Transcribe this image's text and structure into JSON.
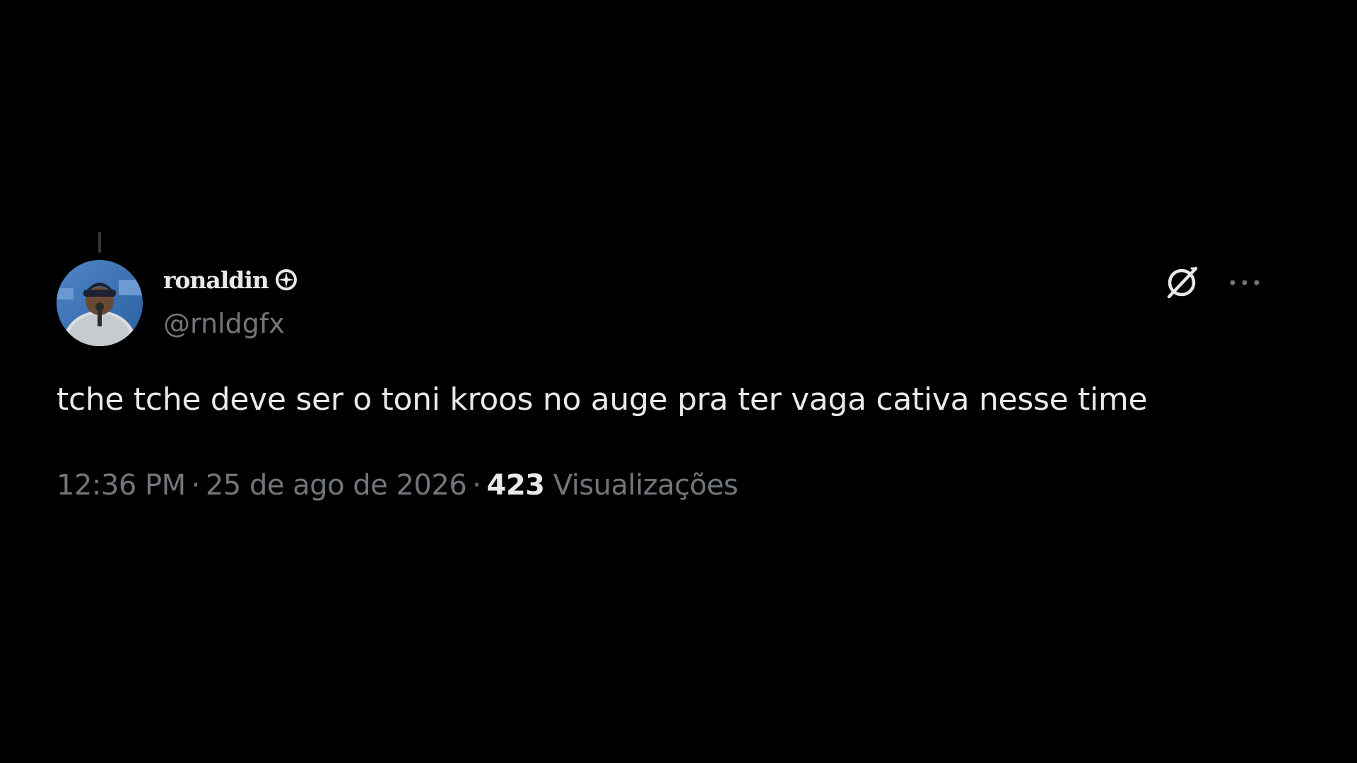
{
  "post": {
    "display_name": "ronaldin",
    "name_emblem": "badge-emblem-icon",
    "handle": "@rnldgfx",
    "text": "tche tche deve ser o toni kroos no auge pra ter vaga cativa nesse time",
    "time": "12:36 PM",
    "date": "25 de ago de 2026",
    "separator": "·",
    "views_count": "423",
    "views_label": "Visualizações"
  },
  "icons": {
    "grok": "grok-icon",
    "more": "more-icon"
  },
  "colors": {
    "background": "#000000",
    "primary_text": "#e7e9ea",
    "secondary_text": "#71767b"
  }
}
